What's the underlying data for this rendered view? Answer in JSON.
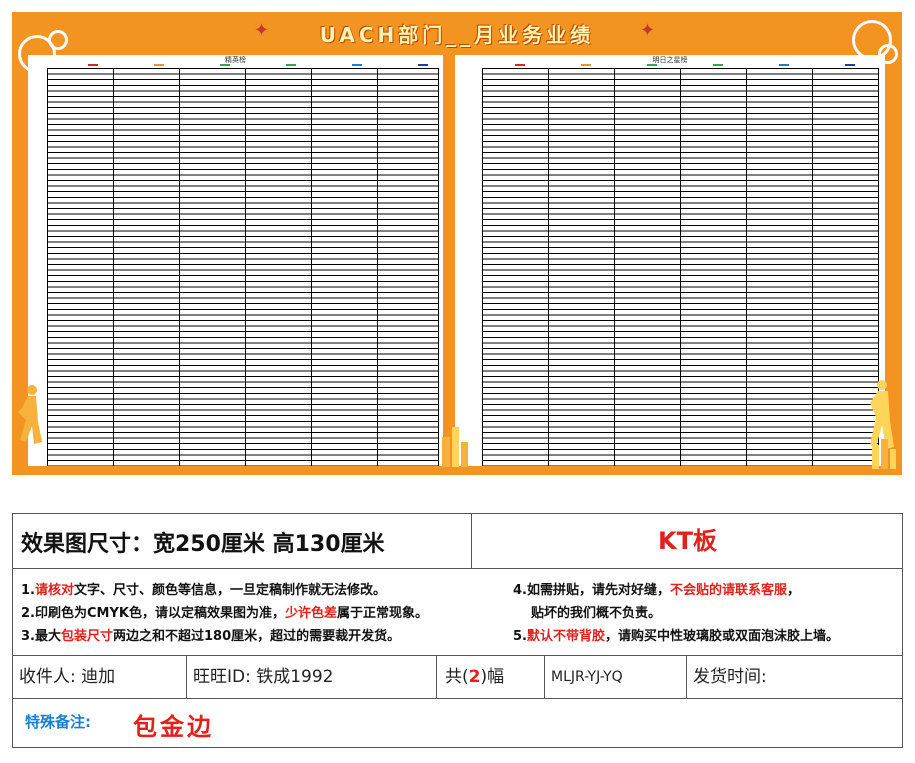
{
  "board": {
    "title": "UACH部门__月业务业绩",
    "left_panel_title": "精英榜",
    "right_panel_title": "明日之星榜",
    "column_tag_colors": [
      "#e0221b",
      "#f39322",
      "#2fa84f",
      "#2fa84f",
      "#1a7fd4",
      "#1c3fa8"
    ],
    "accent_color": "#f39322"
  },
  "info": {
    "size_text": "效果图尺寸：宽250厘米  高130厘米",
    "material": "KT板",
    "notes": {
      "n1_a": "1.",
      "n1_red": "请核对",
      "n1_b": "文字、尺寸、颜色等信息，一旦定稿制作就无法修改。",
      "n2_a": "2.印刷色为CMYK色，请以定稿效果图为准，",
      "n2_red": "少许色差",
      "n2_b": "属于正常现象。",
      "n3_a": "3.最大",
      "n3_red": "包装尺寸",
      "n3_b": "两边之和不超过180厘米，超过的需要裁开发货。",
      "n4_a": "4.如需拼贴，请先对好缝，",
      "n4_red": "不会贴的请联系客服",
      "n4_b": "，",
      "n4_c": "贴坏的我们概不负责。",
      "n5_a": "5.",
      "n5_red": "默认不带背胶",
      "n5_b": "，请购买中性玻璃胶或双面泡沫胶上墙。"
    },
    "recipient": "收件人:  迪加",
    "wangwang": "旺旺ID:  铁成1992",
    "count_prefix": "共(",
    "count_value": "2",
    "count_suffix": ")幅",
    "code": "MLJR-YJ-YQ",
    "ship_time": "发货时间:",
    "remark_label": "特殊备注:",
    "remark_value": "包金边"
  }
}
